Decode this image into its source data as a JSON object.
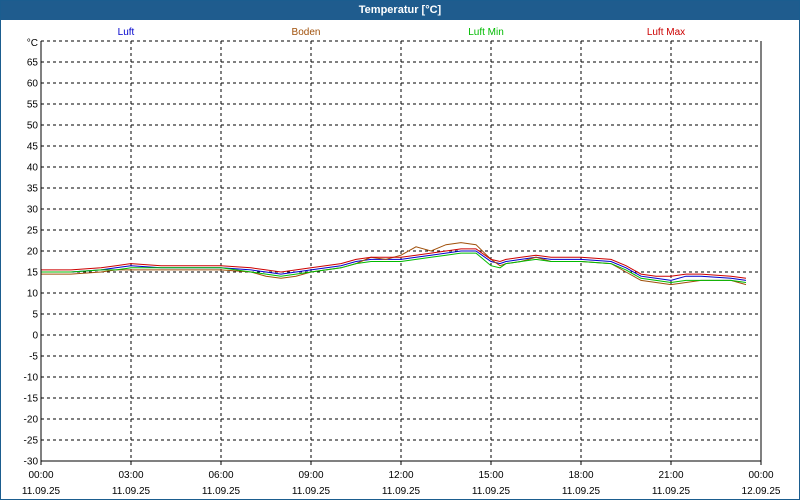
{
  "window": {
    "title": "Temperatur [°C]"
  },
  "colors": {
    "titlebar": "#1f5c8e",
    "grid": "#000000"
  },
  "chart_data": {
    "type": "line",
    "title": "Temperatur [°C]",
    "ylabel": "°C",
    "xlabel": "",
    "ylim": [
      -30,
      70
    ],
    "y_ticks": [
      -30,
      -25,
      -20,
      -15,
      -10,
      -5,
      0,
      5,
      10,
      15,
      20,
      25,
      30,
      35,
      40,
      45,
      50,
      55,
      60,
      65
    ],
    "xlim": [
      0,
      24
    ],
    "x_ticks": [
      {
        "time": "00:00",
        "date": "11.09.25"
      },
      {
        "time": "03:00",
        "date": "11.09.25"
      },
      {
        "time": "06:00",
        "date": "11.09.25"
      },
      {
        "time": "09:00",
        "date": "11.09.25"
      },
      {
        "time": "12:00",
        "date": "11.09.25"
      },
      {
        "time": "15:00",
        "date": "11.09.25"
      },
      {
        "time": "18:00",
        "date": "11.09.25"
      },
      {
        "time": "21:00",
        "date": "11.09.25"
      },
      {
        "time": "00:00",
        "date": "12.09.25"
      }
    ],
    "grid": true,
    "legend_position": "top",
    "series": [
      {
        "name": "Luft",
        "color": "#0000cc",
        "x": [
          0,
          1,
          2,
          2.5,
          3,
          4,
          5,
          6,
          7,
          7.5,
          8,
          8.5,
          9,
          10,
          10.5,
          11,
          12,
          12.5,
          13,
          13.5,
          14,
          14.5,
          15,
          15.3,
          15.5,
          16,
          16.5,
          17,
          18,
          19,
          19.5,
          20,
          20.5,
          21,
          21.5,
          22,
          23,
          23.5
        ],
        "y": [
          15,
          15,
          15.5,
          16,
          16.5,
          16,
          16,
          16,
          15.5,
          15,
          14.5,
          15,
          15.5,
          16.5,
          17.5,
          18,
          18,
          18.5,
          19,
          19.5,
          20,
          20,
          17.5,
          17,
          17.5,
          18,
          18.5,
          18,
          18,
          17.5,
          16,
          14,
          13.5,
          13,
          14,
          14,
          13.5,
          13
        ]
      },
      {
        "name": "Boden",
        "color": "#a0500a",
        "x": [
          0,
          1,
          2,
          2.5,
          3,
          4,
          5,
          6,
          7,
          7.5,
          8,
          8.5,
          9,
          10,
          10.5,
          11,
          11.5,
          12,
          12.5,
          13,
          13.5,
          14,
          14.5,
          15,
          15.3,
          15.5,
          16,
          16.5,
          17,
          18,
          19,
          19.5,
          20,
          20.5,
          21,
          21.5,
          22,
          23,
          23.5
        ],
        "y": [
          14.5,
          14.5,
          15,
          15.5,
          15.5,
          15.5,
          15.5,
          15.5,
          15,
          14,
          13.5,
          14,
          15,
          16,
          17,
          18.5,
          18,
          19,
          21,
          20,
          21.5,
          22,
          21.5,
          18,
          16.5,
          17,
          17.5,
          18.5,
          17.5,
          17.5,
          17,
          15,
          13,
          12.5,
          12,
          12.5,
          13,
          13,
          12
        ]
      },
      {
        "name": "Luft Min",
        "color": "#00bb00",
        "x": [
          0,
          1,
          2,
          2.5,
          3,
          4,
          5,
          6,
          7,
          7.5,
          8,
          8.5,
          9,
          10,
          10.5,
          11,
          12,
          12.5,
          13,
          13.5,
          14,
          14.5,
          15,
          15.3,
          15.5,
          16,
          16.5,
          17,
          18,
          19,
          19.5,
          20,
          20.5,
          21,
          21.5,
          22,
          23,
          23.5
        ],
        "y": [
          15,
          15,
          15.5,
          15.5,
          16,
          16,
          16,
          16,
          15,
          14.5,
          14,
          14.5,
          15,
          16,
          17,
          17.5,
          17.5,
          18,
          18.5,
          19,
          19.5,
          19.5,
          16.5,
          16,
          17,
          17.5,
          18,
          17.5,
          17.5,
          17,
          15.5,
          13.5,
          13,
          12.5,
          13,
          13,
          13,
          12.5
        ]
      },
      {
        "name": "Luft Max",
        "color": "#cc0000",
        "x": [
          0,
          1,
          2,
          2.5,
          3,
          4,
          5,
          6,
          7,
          7.5,
          8,
          8.5,
          9,
          10,
          10.5,
          11,
          12,
          12.5,
          13,
          13.5,
          14,
          14.5,
          15,
          15.3,
          15.5,
          16,
          16.5,
          17,
          18,
          19,
          19.5,
          20,
          20.5,
          21,
          21.5,
          22,
          23,
          23.5
        ],
        "y": [
          15.5,
          15.5,
          16,
          16.5,
          17,
          16.5,
          16.5,
          16.5,
          16,
          15.5,
          15,
          15.5,
          16,
          17,
          18,
          18.5,
          18.5,
          19,
          19.5,
          20,
          20.5,
          20.5,
          18,
          17.5,
          18,
          18.5,
          19,
          18.5,
          18.5,
          18,
          16.5,
          14.5,
          14,
          14,
          14.5,
          14.5,
          14,
          13.5
        ]
      }
    ]
  }
}
